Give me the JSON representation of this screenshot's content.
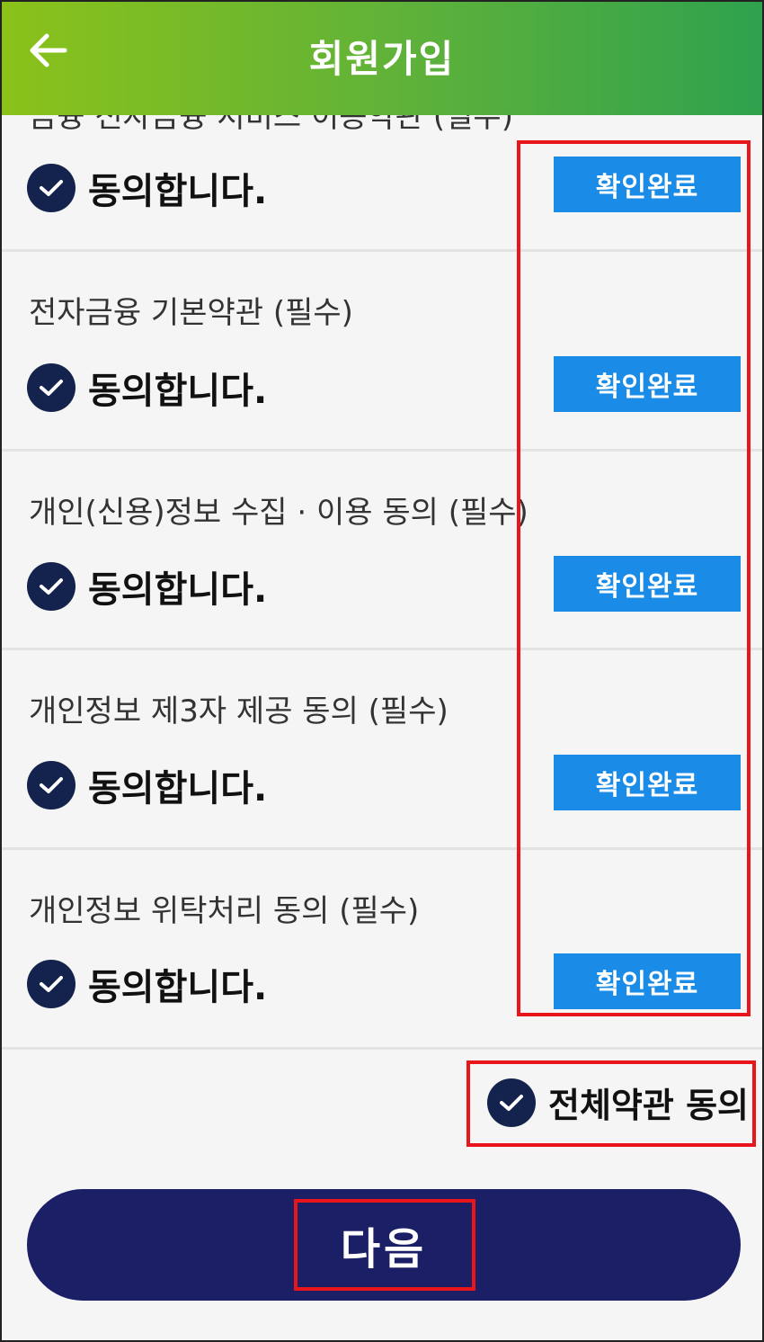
{
  "header": {
    "title": "회원가입"
  },
  "partial_title": "금융 전자금융 서비스 이용약관 (필수)",
  "agree_label": "동의합니다.",
  "confirm_label": "확인완료",
  "sections": [
    {
      "title": "전자금융 기본약관 (필수)"
    },
    {
      "title": "개인(신용)정보 수집 · 이용 동의 (필수)"
    },
    {
      "title": "개인정보 제3자 제공 동의 (필수)"
    },
    {
      "title": "개인정보 위탁처리 동의 (필수)"
    }
  ],
  "all_agree": {
    "label": "전체약관 동의"
  },
  "next_button": {
    "label": "다음"
  },
  "colors": {
    "header_start": "#8bc21a",
    "header_end": "#2fa24e",
    "check": "#14234d",
    "confirm": "#1a8be6",
    "next": "#1b1f66",
    "highlight": "#e8161b"
  }
}
